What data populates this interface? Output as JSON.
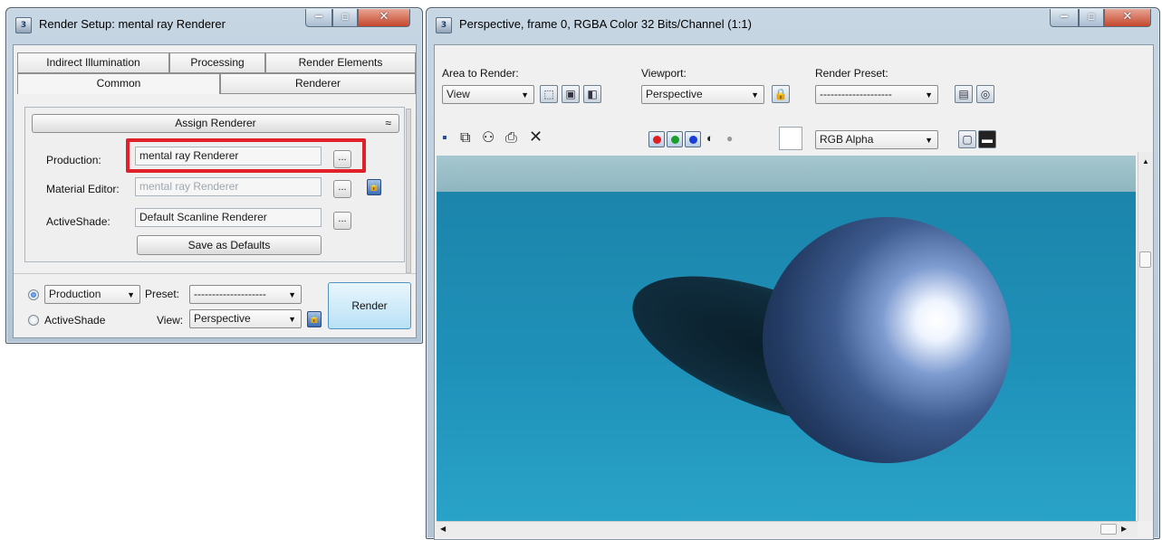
{
  "render_setup": {
    "title": "Render Setup: mental ray Renderer",
    "tabs_row1": [
      "Indirect Illumination",
      "Processing",
      "Render Elements"
    ],
    "tabs_row2": [
      "Common",
      "Renderer"
    ],
    "rollout_title": "Assign Renderer",
    "rollout_toggle": "≈",
    "production_label": "Production:",
    "production_value": "mental ray Renderer",
    "material_editor_label": "Material Editor:",
    "material_editor_value": "mental ray Renderer",
    "activeshade_label": "ActiveShade:",
    "activeshade_value": "Default Scanline Renderer",
    "browse_label": "...",
    "save_defaults_label": "Save as Defaults",
    "mode_production": "Production",
    "mode_activeshade": "ActiveShade",
    "preset_label": "Preset:",
    "preset_value": "--------------------",
    "view_label": "View:",
    "view_value": "Perspective",
    "render_label": "Render",
    "highlight_color": "#e0202a"
  },
  "frame_window": {
    "title": "Perspective, frame 0, RGBA Color 32 Bits/Channel (1:1)",
    "area_label": "Area to Render:",
    "area_value": "View",
    "viewport_label": "Viewport:",
    "viewport_value": "Perspective",
    "preset_label": "Render Preset:",
    "preset_value": "--------------------",
    "channel_value": "RGB Alpha",
    "scene_colors": {
      "floor": "#1f8fb4",
      "background_strip": "#9fbfc6",
      "sphere_base": "#253f6b",
      "sphere_highlight": "#ffffff",
      "shadow": "#0f2a3a"
    }
  },
  "icons": {
    "minimize": "minimize-icon",
    "maximize": "maximize-icon",
    "close": "close-icon",
    "lock": "lock-icon",
    "save": "save-icon",
    "copy": "copy-icon",
    "clone": "clone-icon",
    "print": "print-icon",
    "clear": "clear-icon"
  }
}
